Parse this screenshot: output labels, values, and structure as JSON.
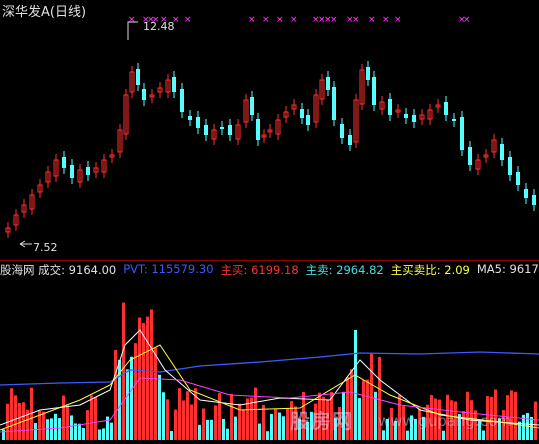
{
  "main_chart": {
    "title": "深华发A(日线)",
    "high_label": "12.48",
    "low_label": "7.52"
  },
  "indicator_bar": {
    "items": [
      {
        "label": "股海网 成交: 9164.00",
        "color": "#e0e0e0"
      },
      {
        "label": "PVT: 115579.30",
        "color": "#3a5bff"
      },
      {
        "label": "主买: 6199.18",
        "color": "#ff3030"
      },
      {
        "label": "主卖: 2964.82",
        "color": "#40e0e0"
      },
      {
        "label": "主买卖比: 2.09",
        "color": "#ffff40"
      },
      {
        "label": "MA5: 9617",
        "color": "#e0e0e0"
      }
    ]
  },
  "watermark": {
    "text": "股房网",
    "url": "www.gupang.com"
  },
  "colors": {
    "up": "#ff3030",
    "down": "#54ffff",
    "marker": "#ff40ff",
    "pvt": "#3a5bff",
    "ma_white": "#ffffff",
    "ma_yellow": "#ffff40",
    "ma_magenta": "#ff40ff"
  }
}
